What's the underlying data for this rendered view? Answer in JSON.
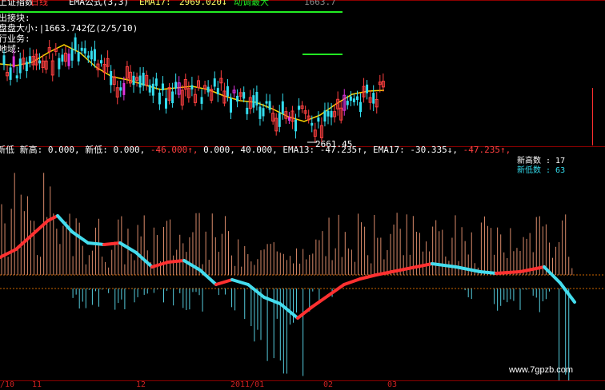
{
  "top_panel": {
    "title_fragments": [
      "上证指数",
      "日线",
      "EMA公式(3,3)",
      "EMA17:",
      "2969.020↓",
      "动调最大",
      "1663.7"
    ],
    "info_lines": [
      "出接块:",
      "盘盘大小:|1663.742亿(2/5/10)",
      "行业务:",
      "地域:"
    ],
    "low_label": "2661.45",
    "ema_line_color": "#ffd700",
    "colors": {
      "up": "#ff4040",
      "down": "#33ddee",
      "magenta": "#dd33dd",
      "green": "#22ee22"
    }
  },
  "indicator_header": {
    "parts": [
      {
        "text": "新低 新高: 0.000,",
        "color": "#ffffff"
      },
      {
        "text": "新低: 0.000,",
        "color": "#ffffff"
      },
      {
        "text": "-46.000↑,",
        "color": "#ff4040"
      },
      {
        "text": "0.000, 40.000,",
        "color": "#ffffff"
      },
      {
        "text": "EMA13: -47.235↑,",
        "color": "#ffffff"
      },
      {
        "text": "EMA17: -30.335↓,",
        "color": "#ffffff"
      },
      {
        "text": "-47.235↑,",
        "color": "#ff4040"
      }
    ]
  },
  "legend": {
    "new_high": "新高数 : 17",
    "new_low": "新低数 : 63"
  },
  "bottom_axis": {
    "labels": [
      "/10",
      "11",
      "12",
      "2011/01",
      "02",
      "03"
    ]
  },
  "watermark": "www.7gpzb.com"
}
